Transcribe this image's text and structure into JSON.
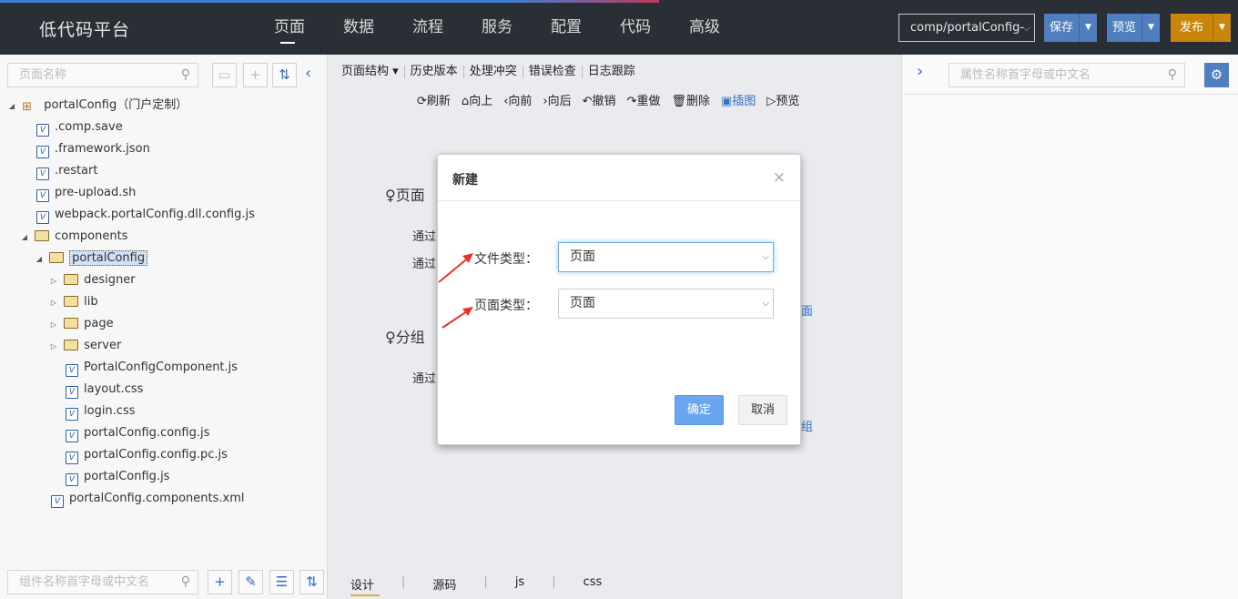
{
  "header": {
    "app_title": "低代码平台",
    "nav": [
      "页面",
      "数据",
      "流程",
      "服务",
      "配置",
      "代码",
      "高级"
    ],
    "active_nav": "页面",
    "component_select": "comp/portalConfig-",
    "save_label": "保存",
    "preview_label": "预览",
    "publish_label": "发布"
  },
  "left_panel": {
    "search_placeholder": "页面名称",
    "bottom_search_placeholder": "组件名称首字母或中文名",
    "tree": [
      {
        "label": "portalConfig（门户定制）",
        "type": "package",
        "expanded": true
      },
      {
        "label": ".comp.save",
        "type": "file"
      },
      {
        "label": ".framework.json",
        "type": "file"
      },
      {
        "label": ".restart",
        "type": "file"
      },
      {
        "label": "pre-upload.sh",
        "type": "file"
      },
      {
        "label": "webpack.portalConfig.dll.config.js",
        "type": "file"
      },
      {
        "label": "components",
        "type": "folder",
        "expanded": true
      },
      {
        "label": "portalConfig",
        "type": "folder",
        "expanded": true,
        "selected": true
      },
      {
        "label": "designer",
        "type": "folder"
      },
      {
        "label": "lib",
        "type": "folder"
      },
      {
        "label": "page",
        "type": "folder"
      },
      {
        "label": "server",
        "type": "folder"
      },
      {
        "label": "PortalConfigComponent.js",
        "type": "file"
      },
      {
        "label": "layout.css",
        "type": "file"
      },
      {
        "label": "login.css",
        "type": "file"
      },
      {
        "label": "portalConfig.config.js",
        "type": "file"
      },
      {
        "label": "portalConfig.config.pc.js",
        "type": "file"
      },
      {
        "label": "portalConfig.js",
        "type": "file"
      },
      {
        "label": "portalConfig.components.xml",
        "type": "file"
      }
    ]
  },
  "center": {
    "tabs": [
      "页面结构 ▾",
      "历史版本",
      "处理冲突",
      "错误检查",
      "日志跟踪"
    ],
    "toolbar": [
      "刷新",
      "向上",
      "向前",
      "向后",
      "撤销",
      "重做",
      "删除",
      "插图",
      "预览"
    ],
    "section1_title": "页面",
    "section1_line1": "通过",
    "section1_line2": "通过",
    "section1_link": "面",
    "section2_title": "分组",
    "section2_line1": "通过",
    "section2_link": "组",
    "bottom_tabs": [
      "设计",
      "源码",
      "js",
      "css"
    ]
  },
  "right_panel": {
    "search_placeholder": "属性名称首字母或中文名"
  },
  "modal": {
    "title": "新建",
    "close": "×",
    "file_type_label": "文件类型：",
    "file_type_value": "页面",
    "page_type_label": "页面类型：",
    "page_type_value": "页面",
    "ok_label": "确定",
    "cancel_label": "取消"
  },
  "colors": {
    "topbar_bg": "#2a2f36",
    "primary": "#4f7fbf",
    "publish": "#c8860a",
    "link": "#2f6fc4",
    "annotation_arrow": "#e8332a"
  }
}
